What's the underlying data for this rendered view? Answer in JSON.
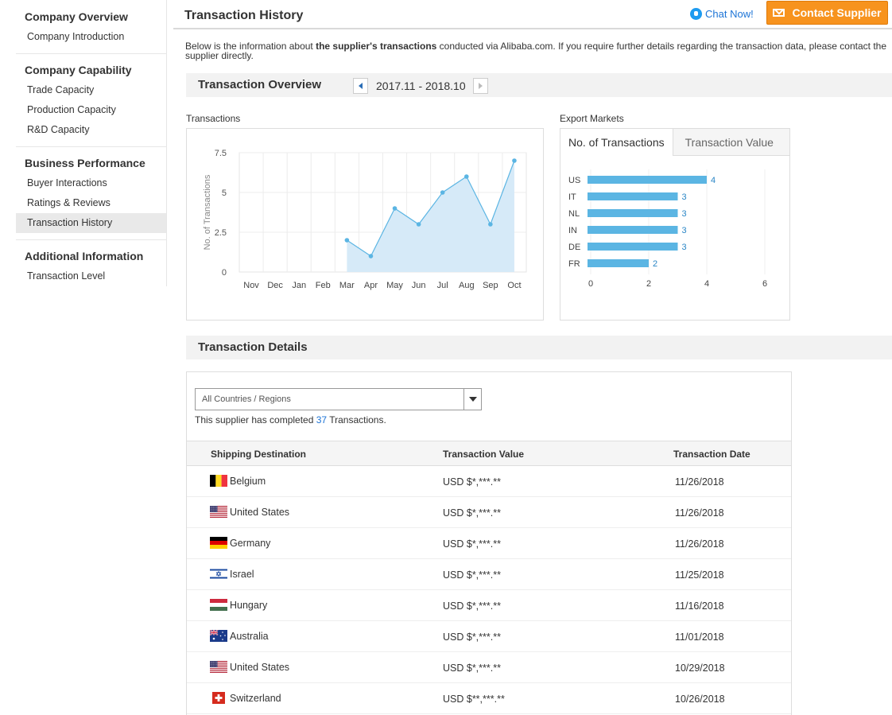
{
  "sidebar": {
    "groups": [
      {
        "title": "Company Overview",
        "items": [
          "Company Introduction"
        ]
      },
      {
        "title": "Company Capability",
        "items": [
          "Trade Capacity",
          "Production Capacity",
          "R&D Capacity"
        ]
      },
      {
        "title": "Business Performance",
        "items": [
          "Buyer Interactions",
          "Ratings & Reviews",
          "Transaction History"
        ]
      },
      {
        "title": "Additional Information",
        "items": [
          "Transaction Level"
        ]
      }
    ],
    "active_item": "Transaction History"
  },
  "header": {
    "title": "Transaction History",
    "chat_label": "Chat Now!",
    "contact_label": "Contact Supplier"
  },
  "intro": {
    "before": "Below is the information about ",
    "bold": "the supplier's transactions",
    "after": " conducted via Alibaba.com. If you require further details regarding the transaction data, please contact the supplier directly."
  },
  "overview": {
    "title": "Transaction Overview",
    "date_range": "2017.11 - 2018.10"
  },
  "transactions_chart_label": "Transactions",
  "export_markets": {
    "label": "Export Markets",
    "tabs": [
      "No. of Transactions",
      "Transaction Value"
    ],
    "active_tab": "No. of Transactions"
  },
  "chart_data": [
    {
      "type": "area",
      "title": "Transactions",
      "xlabel": "",
      "ylabel": "No. of Transactions",
      "categories": [
        "Nov",
        "Dec",
        "Jan",
        "Feb",
        "Mar",
        "Apr",
        "May",
        "Jun",
        "Jul",
        "Aug",
        "Sep",
        "Oct"
      ],
      "values": [
        null,
        null,
        null,
        null,
        2,
        1,
        4,
        3,
        5,
        6,
        3,
        7
      ],
      "yticks": [
        "0",
        "2.5",
        "5",
        "7.5"
      ],
      "ylim": [
        0,
        7.5
      ],
      "grid": true,
      "color": "#5bb5e3",
      "fill": "#d6eaf8"
    },
    {
      "type": "bar",
      "orientation": "horizontal",
      "title": "Export Markets",
      "categories": [
        "US",
        "IT",
        "NL",
        "IN",
        "DE",
        "FR"
      ],
      "values": [
        4,
        3,
        3,
        3,
        3,
        2
      ],
      "xticks": [
        "0",
        "2",
        "4",
        "6"
      ],
      "xlim": [
        0,
        6
      ],
      "color": "#5bb5e3"
    }
  ],
  "details": {
    "title": "Transaction Details",
    "filter_value": "All Countries / Regions",
    "completed_prefix": "This supplier has completed ",
    "completed_count": "37",
    "completed_suffix": " Transactions.",
    "columns": [
      "Shipping Destination",
      "Transaction Value",
      "Transaction Date"
    ],
    "rows": [
      {
        "country": "Belgium",
        "flag": "belgium-flag-icon",
        "value": "USD $*,***.**",
        "date": "11/26/2018"
      },
      {
        "country": "United States",
        "flag": "us-flag-icon",
        "value": "USD $*,***.**",
        "date": "11/26/2018"
      },
      {
        "country": "Germany",
        "flag": "germany-flag-icon",
        "value": "USD $*,***.**",
        "date": "11/26/2018"
      },
      {
        "country": "Israel",
        "flag": "israel-flag-icon",
        "value": "USD $*,***.**",
        "date": "11/25/2018"
      },
      {
        "country": "Hungary",
        "flag": "hungary-flag-icon",
        "value": "USD $*,***.**",
        "date": "11/16/2018"
      },
      {
        "country": "Australia",
        "flag": "australia-flag-icon",
        "value": "USD $*,***.**",
        "date": "11/01/2018"
      },
      {
        "country": "United States",
        "flag": "us-flag-icon",
        "value": "USD $*,***.**",
        "date": "10/29/2018"
      },
      {
        "country": "Switzerland",
        "flag": "switzerland-flag-icon",
        "value": "USD $**,***.**",
        "date": "10/26/2018"
      }
    ]
  },
  "colors": {
    "accent_orange": "#f7931e",
    "link_blue": "#1d74d6",
    "chart_blue": "#5bb5e3"
  }
}
